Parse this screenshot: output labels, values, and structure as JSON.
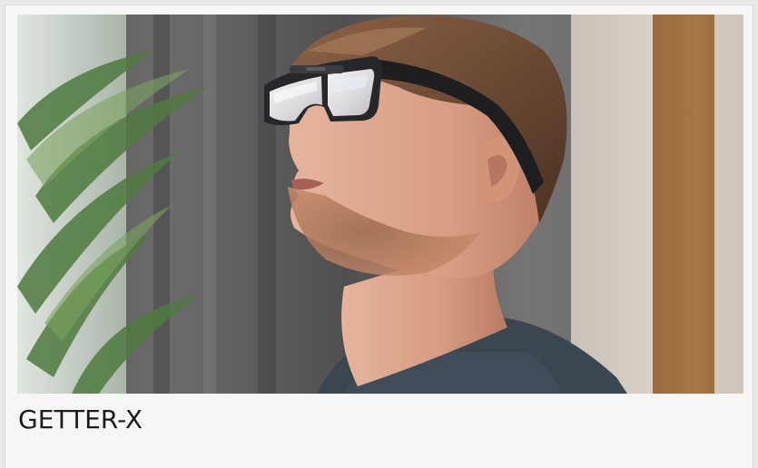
{
  "product": {
    "name": "GETTER-X",
    "image_subject": "man-wearing-getter-x-glasses"
  }
}
